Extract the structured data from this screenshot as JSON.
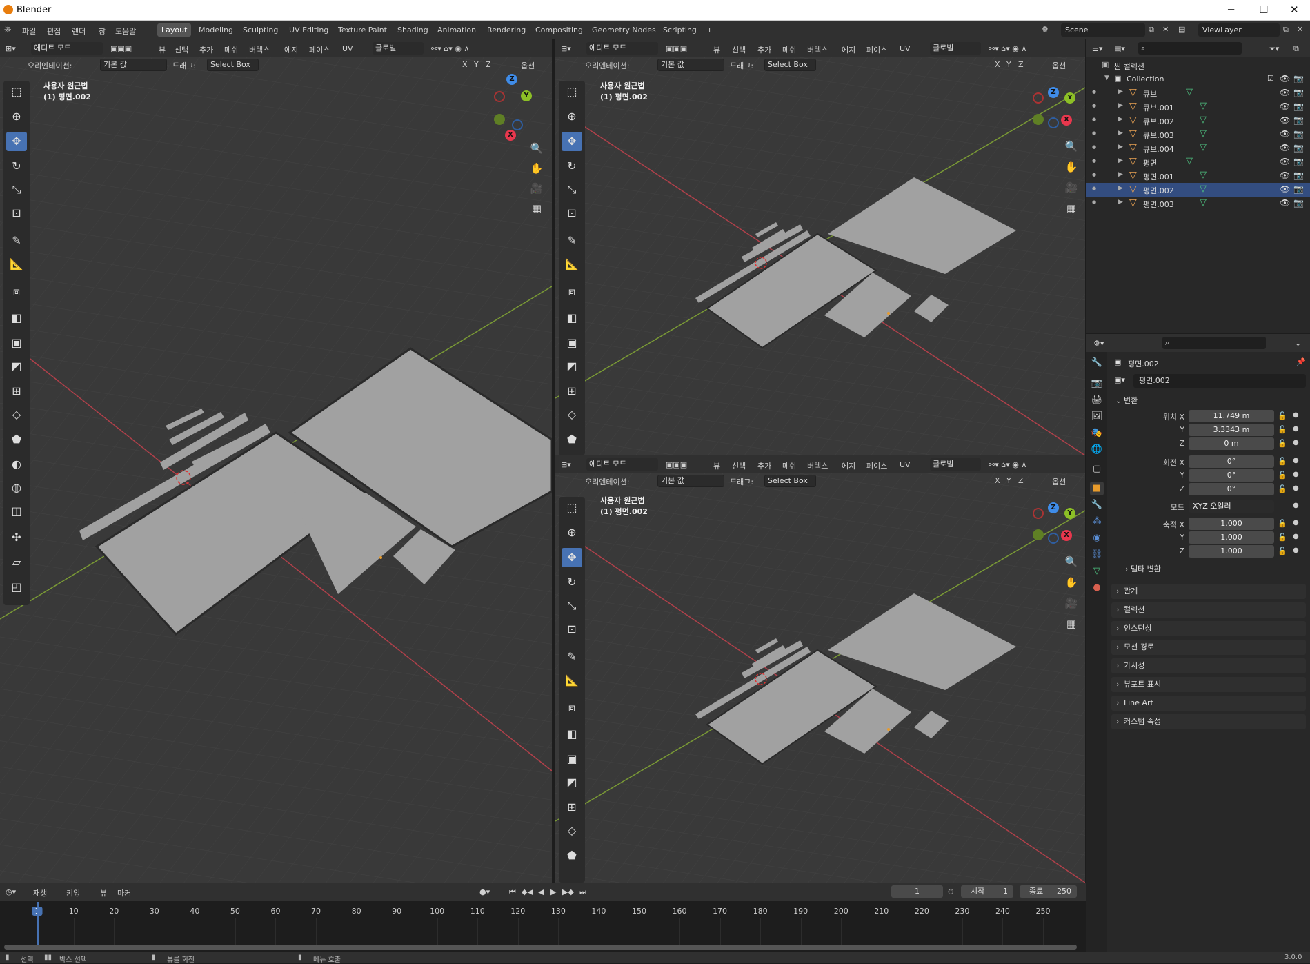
{
  "window": {
    "title": "Blender",
    "minimize": "─",
    "maximize": "☐",
    "close": "✕"
  },
  "menu": [
    "파일",
    "편집",
    "렌더",
    "창",
    "도움말"
  ],
  "workspaces": [
    {
      "label": "Layout",
      "active": true
    },
    {
      "label": "Modeling"
    },
    {
      "label": "Sculpting"
    },
    {
      "label": "UV Editing"
    },
    {
      "label": "Texture Paint"
    },
    {
      "label": "Shading"
    },
    {
      "label": "Animation"
    },
    {
      "label": "Rendering"
    },
    {
      "label": "Compositing"
    },
    {
      "label": "Geometry Nodes"
    },
    {
      "label": "Scripting"
    }
  ],
  "add_workspace": "+",
  "scene": {
    "scene_name": "Scene",
    "view_layer": "ViewLayer"
  },
  "viewport": {
    "mode": "에디트 모드",
    "menus": [
      "뷰",
      "선택",
      "추가",
      "메쉬",
      "버텍스",
      "에지",
      "페이스",
      "UV"
    ],
    "transform_orientation": "글로벌",
    "orientation_label": "오리엔테이션:",
    "orientation_value": "기본 값",
    "drag_label": "드래그:",
    "drag_value": "Select Box",
    "axes": [
      "X",
      "Y",
      "Z"
    ],
    "options": "옵션",
    "overlay_line1": "사용자 원근법",
    "overlay_line2": "(1) 평면.002",
    "gizmo": {
      "x": "X",
      "y": "Y",
      "z": "Z"
    }
  },
  "outliner": {
    "scene_collection": "씬 컬렉션",
    "collection": "Collection",
    "items": [
      {
        "name": "큐브"
      },
      {
        "name": "큐브.001"
      },
      {
        "name": "큐브.002"
      },
      {
        "name": "큐브.003"
      },
      {
        "name": "큐브.004"
      },
      {
        "name": "평면"
      },
      {
        "name": "평면.001"
      },
      {
        "name": "평면.002",
        "selected": true
      },
      {
        "name": "평면.003"
      }
    ]
  },
  "properties": {
    "object_name": "평면.002",
    "data_name": "평면.002",
    "transform_label": "변환",
    "location_label": "위치 X",
    "location": {
      "x": "11.749 m",
      "y": "3.3343 m",
      "z": "0 m"
    },
    "rotation_label": "회전 X",
    "rotation": {
      "x": "0°",
      "y": "0°",
      "z": "0°"
    },
    "mode_label": "모드",
    "mode_value": "XYZ 오일러",
    "scale_label": "축적 X",
    "scale": {
      "x": "1.000",
      "y": "1.000",
      "z": "1.000"
    },
    "y_label": "Y",
    "z_label": "Z",
    "delta": "델타 변환",
    "sections": [
      "관계",
      "컬렉션",
      "인스턴싱",
      "모션 경로",
      "가시성",
      "뷰포트 표시",
      "Line Art",
      "커스텀 속성"
    ]
  },
  "timeline": {
    "menus": [
      "재생",
      "키잉",
      "뷰",
      "마커"
    ],
    "current_frame": "1",
    "start_label": "시작",
    "start": "1",
    "end_label": "종료",
    "end": "250",
    "ticks": [
      "1",
      "10",
      "20",
      "30",
      "40",
      "50",
      "60",
      "70",
      "80",
      "90",
      "100",
      "110",
      "120",
      "130",
      "140",
      "150",
      "160",
      "170",
      "180",
      "190",
      "200",
      "210",
      "220",
      "230",
      "240",
      "250"
    ]
  },
  "statusbar": {
    "select": "선택",
    "box_select": "박스 선택",
    "rotate_view": "뷰를 회전",
    "call_menu": "메뉴 호출",
    "version": "3.0.0"
  },
  "colors": {
    "accent": "#4772b3",
    "x_axis": "#e8374d",
    "y_axis": "#8cbf26",
    "z_axis": "#3f8ce8",
    "object_orange": "#e6a052",
    "mesh_green": "#4fc482"
  }
}
